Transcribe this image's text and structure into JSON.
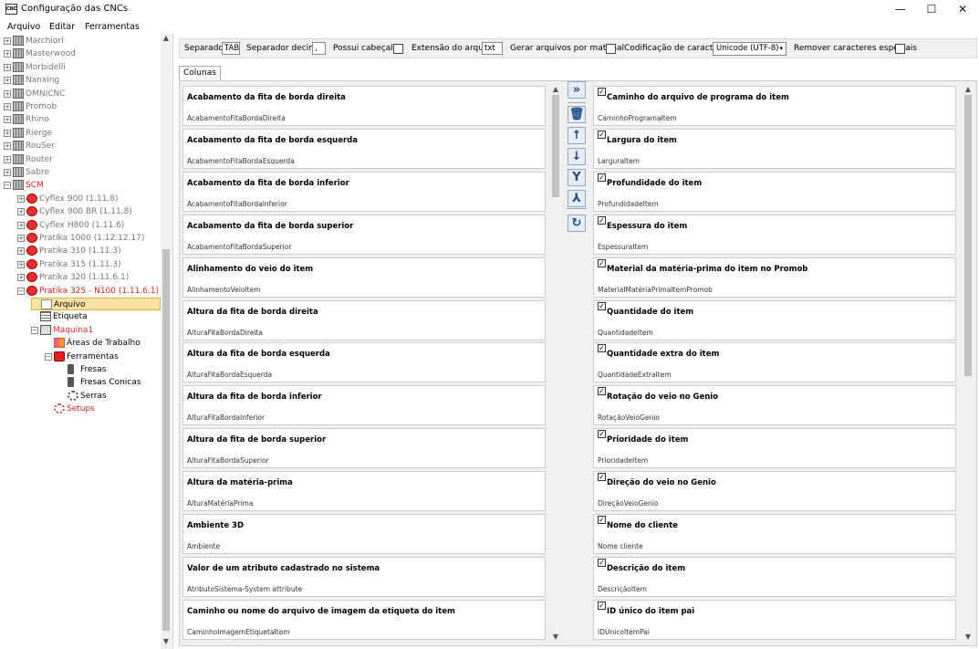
{
  "window": {
    "title": "Configuração das CNCs",
    "icon_text": "CNC",
    "minimize": "—",
    "maximize": "☐",
    "close": "✕"
  },
  "menu": [
    "Arquivo",
    "Editar",
    "Ferramentas"
  ],
  "tree": {
    "machines": [
      "Marchiori",
      "Masterwood",
      "Morbidelli",
      "Nanxing",
      "OMNICNC",
      "Promob",
      "Rhino",
      "Rierge",
      "RouSer",
      "Router",
      "Sabre"
    ],
    "scm": "SCM",
    "scm_children": [
      "Cyflex 900 (1.11.8)",
      "Cyflex 900 BR (1.11.8)",
      "Cyflex H800 (1.11.6)",
      "Pratika 1000 (1.12.12.17)",
      "Pratika 310 (1.11.3)",
      "Pratika 315 (1.11.3)",
      "Pratika 320 (1.11.6.1)"
    ],
    "active_model": "Pratika 325 - N100 (1.11.6.1)",
    "arquivo": "Arquivo",
    "etiqueta": "Etiqueta",
    "maquina": "Maquina1",
    "areas": "Áreas de Trabalho",
    "ferramentas": "Ferramentas",
    "fresas": "Fresas",
    "fresas_conicas": "Fresas Conicas",
    "serras": "Serras",
    "setups": "Setups"
  },
  "toolbar": {
    "separador_label": "Separador",
    "separador_value": "TAB",
    "decimal_label": "Separador decimal",
    "decimal_value": ",",
    "cabecalho_label": "Possui cabeçalho",
    "extensao_label": "Extensão do arquivo",
    "extensao_value": "txt",
    "gerar_label": "Gerar arquivos por material",
    "codificacao_label": "Codificação de caracteres",
    "codificacao_value": "Unicode (UTF-8)",
    "remover_label": "Remover caracteres especiais"
  },
  "tab": "Colunas",
  "available_columns": [
    {
      "title": "Acabamento da fita de borda direita",
      "field": "AcabamentoFitaBordaDireita"
    },
    {
      "title": "Acabamento da fita de borda esquerda",
      "field": "AcabamentoFitaBordaEsquerda"
    },
    {
      "title": "Acabamento da fita de borda inferior",
      "field": "AcabamentoFitaBordaInferior"
    },
    {
      "title": "Acabamento da fita de borda superior",
      "field": "AcabamentoFitaBordaSuperior"
    },
    {
      "title": "Alinhamento do veio do item",
      "field": "AlinhamentoVeioItem"
    },
    {
      "title": "Altura da fita de borda direita",
      "field": "AlturaFitaBordaDireita"
    },
    {
      "title": "Altura da fita de borda esquerda",
      "field": "AlturaFitaBordaEsquerda"
    },
    {
      "title": "Altura da fita de borda inferior",
      "field": "AlturaFitaBordaInferior"
    },
    {
      "title": "Altura da fita de borda superior",
      "field": "AlturaFitaBordaSuperior"
    },
    {
      "title": "Altura da matéria-prima",
      "field": "AlturaMatériaPrima"
    },
    {
      "title": "Ambiente 3D",
      "field": "Ambiente"
    },
    {
      "title": "Valor de um atributo cadastrado no sistema",
      "field": "AtributoSistema-System attribute"
    },
    {
      "title": "Caminho ou nome do arquivo de imagem da etiqueta do item",
      "field": "CaminhoImagemEtiquetaItem"
    }
  ],
  "selected_columns": [
    {
      "title": "Caminho do arquivo de programa do item",
      "field": "CaminhoProgramaItem"
    },
    {
      "title": "Largura do item",
      "field": "LarguraItem"
    },
    {
      "title": "Profundidade do item",
      "field": "ProfundidadeItem"
    },
    {
      "title": "Espessura do item",
      "field": "EspessuraItem"
    },
    {
      "title": "Material da matéria-prima do item no Promob",
      "field": "MaterialMatériaPrimaItemPromob"
    },
    {
      "title": "Quantidade do item",
      "field": "QuantidadeItem"
    },
    {
      "title": "Quantidade extra do item",
      "field": "QuantidadeExtraItem"
    },
    {
      "title": "Rotação do veio no Genio",
      "field": "RotaçãoVeioGenio"
    },
    {
      "title": "Prioridade do item",
      "field": "PrioridadeItem"
    },
    {
      "title": "Direção do veio no Genio",
      "field": "DireçãoVeioGenio"
    },
    {
      "title": "Nome do cliente",
      "field": "Nome cliente"
    },
    {
      "title": "Descrição do item",
      "field": "DescriçãoItem"
    },
    {
      "title": "ID único do item pai",
      "field": "IDÚnicoItemPai"
    }
  ],
  "mid_buttons": [
    {
      "name": "add-all-icon",
      "glyph": "»"
    },
    {
      "name": "trash-icon",
      "glyph": "🗑"
    },
    {
      "name": "arrow-up-icon",
      "glyph": "↑"
    },
    {
      "name": "arrow-down-icon",
      "glyph": "↓"
    },
    {
      "name": "merge-icon",
      "glyph": "Y"
    },
    {
      "name": "split-icon",
      "glyph": "⅄"
    },
    {
      "name": "refresh-icon",
      "glyph": "↻"
    }
  ]
}
